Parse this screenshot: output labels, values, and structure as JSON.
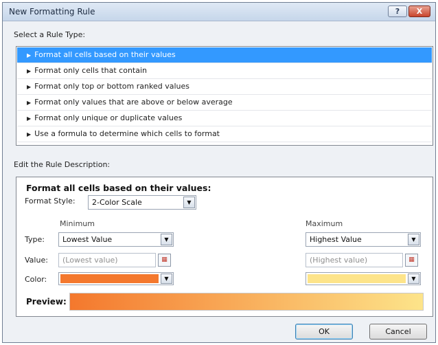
{
  "window": {
    "title": "New Formatting Rule",
    "help_label": "?",
    "close_label": "X"
  },
  "select_rule": {
    "label": "Select a Rule Type:",
    "items": [
      "Format all cells based on their values",
      "Format only cells that contain",
      "Format only top or bottom ranked values",
      "Format only values that are above or below average",
      "Format only unique or duplicate values",
      "Use a formula to determine which cells to format"
    ],
    "selected_index": 0
  },
  "edit_rule": {
    "label": "Edit the Rule Description:",
    "heading": "Format all cells based on their values:",
    "format_style": {
      "label": "Format Style:",
      "value": "2-Color Scale"
    },
    "minimum": {
      "header": "Minimum",
      "type": "Lowest Value",
      "value_placeholder": "(Lowest value)",
      "color": "#f4782d"
    },
    "maximum": {
      "header": "Maximum",
      "type": "Highest Value",
      "value_placeholder": "(Highest value)",
      "color": "#fde48a"
    },
    "row_labels": {
      "type": "Type:",
      "value": "Value:",
      "color": "Color:"
    },
    "preview_label": "Preview:"
  },
  "buttons": {
    "ok": "OK",
    "cancel": "Cancel"
  },
  "icons": {
    "dropdown": "chevron-down-icon",
    "range_select": "range-select-icon",
    "rule_arrow": "arrow-right-icon"
  }
}
